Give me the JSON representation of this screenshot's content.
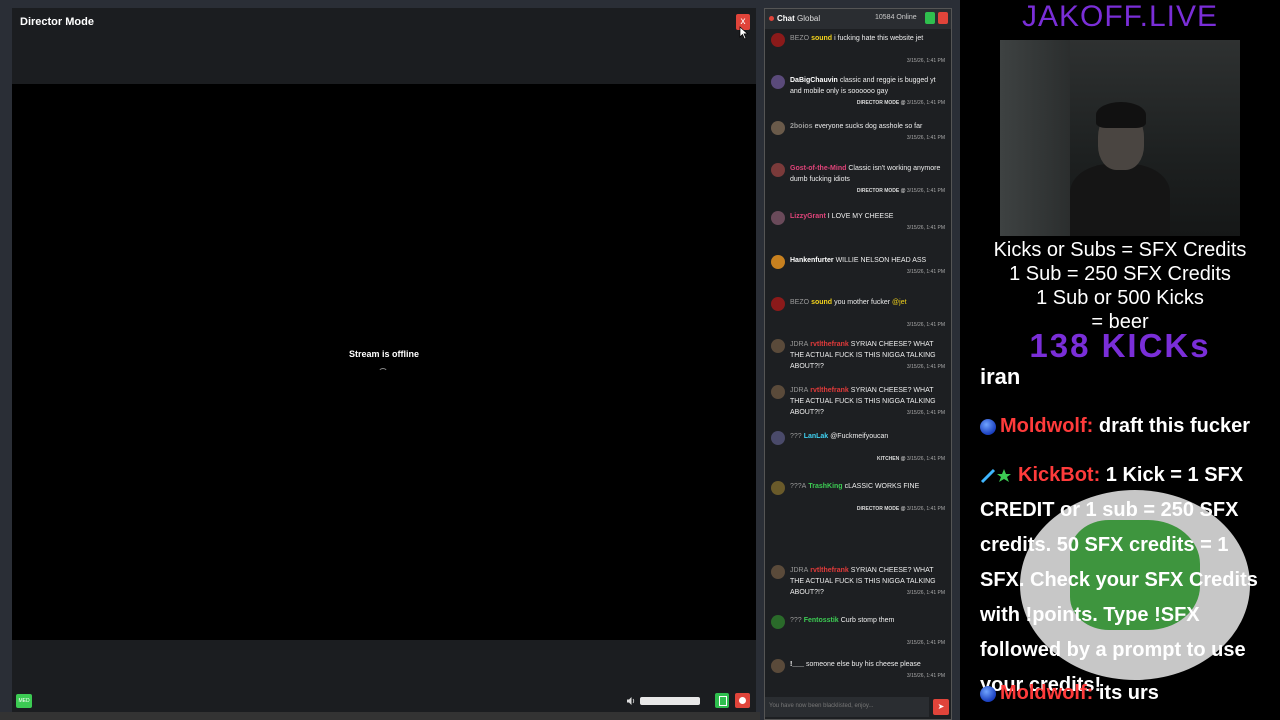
{
  "director": {
    "title": "Director Mode",
    "close_label": "x",
    "offline_text": "Stream is offline",
    "med_label": "MED"
  },
  "chat": {
    "title_prefix": "Chat",
    "title_channel": "Global",
    "online": "10584 Online",
    "input_placeholder": "You have now been blacklisted, enjoy...",
    "send_label": "➤",
    "messages": [
      {
        "badge": "BEZO",
        "user": "sound",
        "user_color": "#f3d31c",
        "text": "i fucking hate this website jet",
        "mention": "",
        "tag": "",
        "time": "3/15/26, 1:41 PM"
      },
      {
        "badge": "",
        "user": "DaBigChauvin",
        "user_color": "#ffffff",
        "text": "classic and reggie is bugged yt and mobile only is soooooo gay",
        "mention": "",
        "tag": "DIRECTOR MODE @",
        "time": "3/15/26, 1:41 PM"
      },
      {
        "badge": "",
        "user": "2boios",
        "user_color": "#999999",
        "text": "everyone sucks dog asshole so far",
        "mention": "",
        "tag": "",
        "time": "3/15/26, 1:41 PM"
      },
      {
        "badge": "",
        "user": "Gost-of-the-Mind",
        "user_color": "#e0447a",
        "text": "Classic isn't working anymore dumb fucking idiots",
        "mention": "",
        "tag": "DIRECTOR MODE @",
        "time": "3/15/26, 1:41 PM"
      },
      {
        "badge": "",
        "user": "LizzyGrant",
        "user_color": "#e0447a",
        "text": "I LOVE MY CHEESE",
        "mention": "",
        "tag": "",
        "time": "3/15/26, 1:41 PM"
      },
      {
        "badge": "",
        "user": "Hankenfurter",
        "user_color": "#ffffff",
        "text": "WILLIE NELSON HEAD ASS",
        "mention": "",
        "tag": "",
        "time": "3/15/26, 1:41 PM"
      },
      {
        "badge": "BEZO",
        "user": "sound",
        "user_color": "#f3d31c",
        "text": "you mother fucker",
        "mention": "@jet",
        "tag": "",
        "time": "3/15/26, 1:41 PM"
      },
      {
        "badge": "JDRA",
        "user": "rvtlthefrank",
        "user_color": "#e03a3a",
        "text": "SYRIAN CHEESE? WHAT THE ACTUAL FUCK IS THIS NIGGA TALKING ABOUT?!?",
        "mention": "",
        "tag": "",
        "time": "3/15/26, 1:41 PM"
      },
      {
        "badge": "JDRA",
        "user": "rvtlthefrank",
        "user_color": "#e03a3a",
        "text": "SYRIAN CHEESE? WHAT THE ACTUAL FUCK IS THIS NIGGA TALKING ABOUT?!?",
        "mention": "",
        "tag": "",
        "time": "3/15/26, 1:41 PM"
      },
      {
        "badge": "???",
        "user": "LanLak",
        "user_color": "#3fd0f0",
        "text": "@Fuckmeifyoucan",
        "mention": "",
        "tag": "KITCHEN @",
        "time": "3/15/26, 1:41 PM"
      },
      {
        "badge": "???A",
        "user": "TrashKing",
        "user_color": "#3ccb53",
        "text": "cLASSIC WORKS FINE",
        "mention": "",
        "tag": "DIRECTOR MODE @",
        "time": "3/15/26, 1:41 PM"
      },
      {
        "badge": "JDRA",
        "user": "rvtlthefrank",
        "user_color": "#e03a3a",
        "text": "SYRIAN CHEESE? WHAT THE ACTUAL FUCK IS THIS NIGGA TALKING ABOUT?!?",
        "mention": "",
        "tag": "",
        "time": "3/15/26, 1:41 PM"
      },
      {
        "badge": "???",
        "user": "Fentosstik",
        "user_color": "#3ccb53",
        "text": "Curb stomp them",
        "mention": "",
        "tag": "",
        "time": "3/15/26, 1:41 PM"
      },
      {
        "badge": "",
        "user": "!___",
        "user_color": "#ffffff",
        "text": "someone else buy his cheese please",
        "mention": "",
        "tag": "",
        "time": "3/15/26, 1:41 PM"
      }
    ]
  },
  "overlay": {
    "brand": "JAKOFF.LIVE",
    "credit_lines": [
      "Kicks or Subs = SFX Credits",
      "1 Sub = 250 SFX Credits",
      "1 Sub or 500 Kicks",
      "= beer"
    ],
    "kicks": "138 KICKs",
    "topic": "iran",
    "chat1_user": "Moldwolf:",
    "chat1_text": "draft this fucker",
    "bot_user": "KickBot:",
    "bot_text": "1 Kick = 1 SFX CREDIT or 1 sub = 250 SFX credits. 50 SFX credits = 1 SFX. Check your SFX Credits with !points. Type !SFX followed by a prompt to use your credits!",
    "chat2_user": "Moldwolf:",
    "chat2_text": "its urs"
  },
  "colors": {
    "accent_red": "#e0443a",
    "accent_green": "#2fbf4e",
    "brand_purple": "#7a2ed8"
  }
}
